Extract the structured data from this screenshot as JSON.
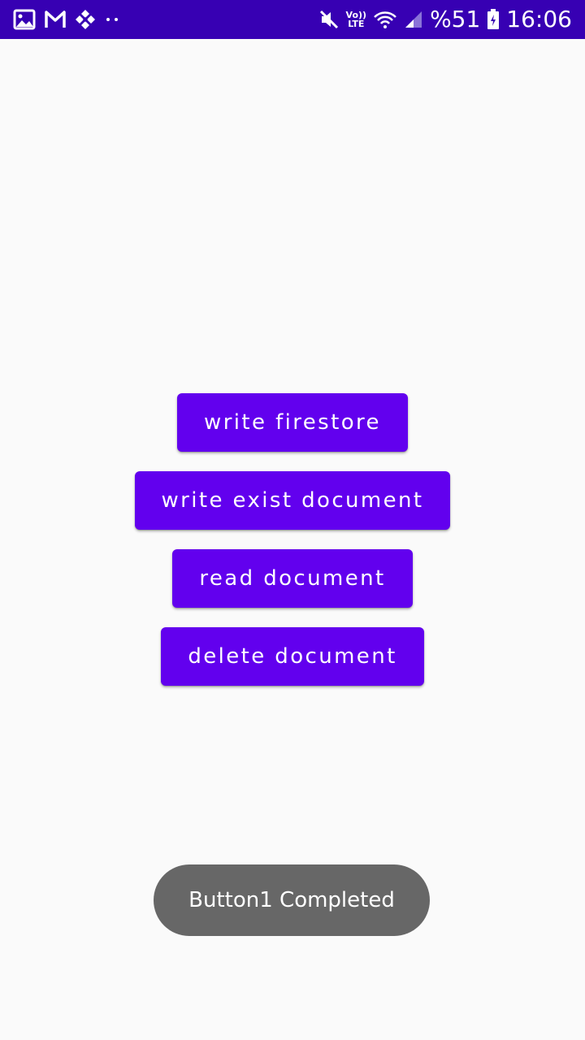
{
  "status_bar": {
    "left_icons": [
      "gallery-icon",
      "gmail-icon",
      "binance-icon",
      "more-notifications-icon"
    ],
    "right_icons": [
      "mute-icon",
      "volte-icon",
      "wifi-icon",
      "signal-icon",
      "battery-icon"
    ],
    "volte_top": "Vo))",
    "volte_bottom": "LTE",
    "battery_percent": "%51",
    "time": "16:06",
    "background_color": "#3700b3"
  },
  "main": {
    "buttons": [
      {
        "label": "write firestore"
      },
      {
        "label": "write exist document"
      },
      {
        "label": "read document"
      },
      {
        "label": "delete document"
      }
    ],
    "button_color": "#6200ee"
  },
  "toast": {
    "message": "Button1 Completed"
  }
}
